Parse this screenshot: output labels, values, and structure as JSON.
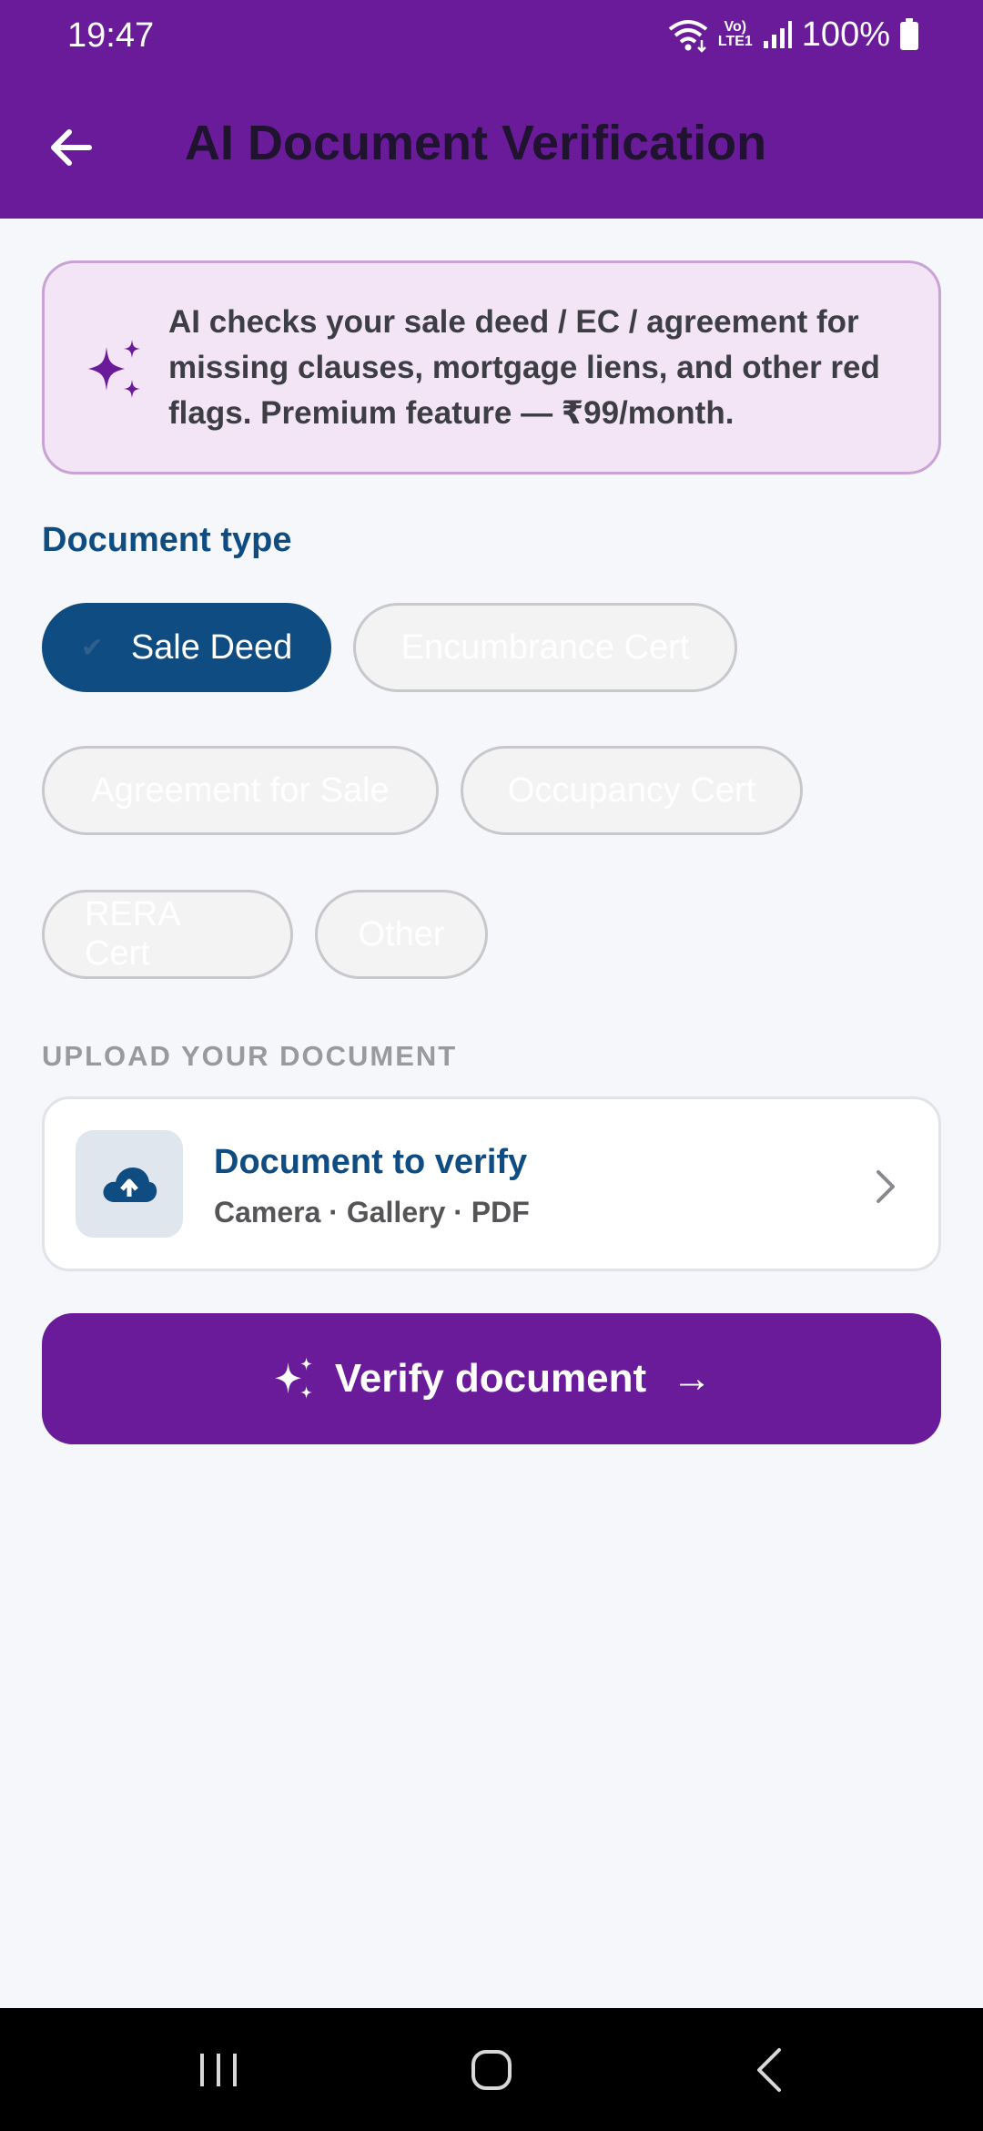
{
  "status_bar": {
    "time": "19:47",
    "battery": "100%",
    "network_label_top": "Vo)",
    "network_label_bottom": "LTE1"
  },
  "app_bar": {
    "title": "AI Document Verification",
    "back_icon": "arrow-left-icon"
  },
  "info_card": {
    "icon": "sparkle-icon",
    "text": "AI checks your sale deed / EC / agreement for missing clauses, mortgage liens, and other red flags. Premium feature — ₹99/month."
  },
  "document_type": {
    "title": "Document type",
    "selected": "Sale Deed",
    "options": [
      {
        "label": "Sale Deed",
        "selected": true
      },
      {
        "label": "Encumbrance Cert",
        "selected": false
      },
      {
        "label": "Agreement for Sale",
        "selected": false
      },
      {
        "label": "Occupancy Cert",
        "selected": false
      },
      {
        "label": "RERA Cert",
        "selected": false
      },
      {
        "label": "Other",
        "selected": false
      }
    ]
  },
  "upload": {
    "section_label": "UPLOAD YOUR DOCUMENT",
    "title": "Document to verify",
    "subtitle": "Camera · Gallery · PDF",
    "icon": "cloud-upload-icon"
  },
  "verify_button": {
    "label": "Verify document",
    "arrow": "→",
    "icon": "sparkle-icon"
  },
  "nav": {
    "recents_icon": "recents-icon",
    "home_icon": "home-icon",
    "back_icon": "back-icon"
  },
  "colors": {
    "primary": "#6a1b9a",
    "accent": "#0f4c81",
    "background": "#f5f7fa",
    "info_bg": "#f3e5f5"
  }
}
